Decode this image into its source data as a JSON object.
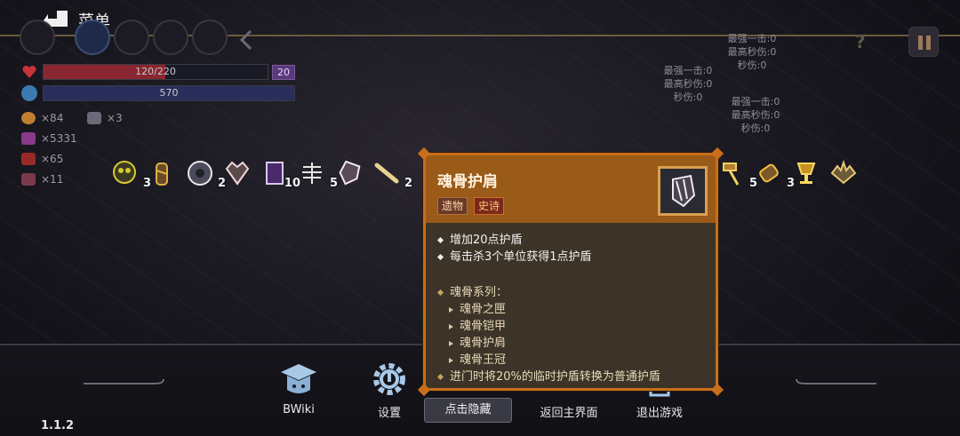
{
  "menu": {
    "title": "菜单"
  },
  "player": {
    "hp_text": "120/220",
    "hp_fraction": 0.545,
    "shield": "20",
    "mp_text": "570",
    "mp_fraction": 1.0
  },
  "resources": [
    {
      "icon": "coin-icon",
      "value": "×84"
    },
    {
      "icon": "key-icon",
      "value": "×3"
    },
    {
      "icon": "gem-icon",
      "value": "×5331"
    },
    {
      "icon": "potion-icon",
      "value": "×65"
    },
    {
      "icon": "soul-icon",
      "value": "×11"
    }
  ],
  "damage_stats": [
    {
      "strongest": "最强一击:0",
      "peak": "最高秒伤:0",
      "dps": "秒伤:0"
    },
    {
      "strongest": "最强一击:0",
      "peak": "最高秒伤:0",
      "dps": "秒伤:0"
    },
    {
      "strongest": "最强一击:0",
      "peak": "最高秒伤:0",
      "dps": "秒伤:0"
    }
  ],
  "relics": [
    {
      "icon": "skull-bomb-icon",
      "count": "3"
    },
    {
      "icon": "bandaged-arm-icon",
      "count": ""
    },
    {
      "icon": "dark-orb-icon",
      "count": "2"
    },
    {
      "icon": "heart-armor-icon",
      "count": ""
    },
    {
      "icon": "purple-card-icon",
      "count": "10"
    },
    {
      "icon": "ribcage-icon",
      "count": "5"
    },
    {
      "icon": "bone-shield-icon",
      "count": ""
    },
    {
      "icon": "bone-club-icon",
      "count": "2"
    },
    {
      "icon": "hammer-icon",
      "count": "5"
    },
    {
      "icon": "bandaged-hand-icon",
      "count": "3"
    },
    {
      "icon": "golden-goblet-icon",
      "count": ""
    },
    {
      "icon": "spiky-claw-icon",
      "count": ""
    }
  ],
  "tooltip": {
    "title": "魂骨护肩",
    "tag_type": "遗物",
    "tag_rarity": "史诗",
    "effects": [
      "增加20点护盾",
      "每击杀3个单位获得1点护盾"
    ],
    "set_title": "魂骨系列：",
    "set_items": [
      "魂骨之匣",
      "魂骨铠甲",
      "魂骨护肩",
      "魂骨王冠"
    ],
    "set_bonus": "进门时将20%的临时护盾转换为普通护盾"
  },
  "nav": {
    "wiki": "BWiki",
    "settings": "设置",
    "hide": "点击隐藏",
    "main_menu": "返回主界面",
    "exit": "退出游戏"
  },
  "version": "1.1.2",
  "colors": {
    "accent_orange": "#c96e1a",
    "hp_red": "#8a2630",
    "shield_purple": "#5a3a7a"
  }
}
